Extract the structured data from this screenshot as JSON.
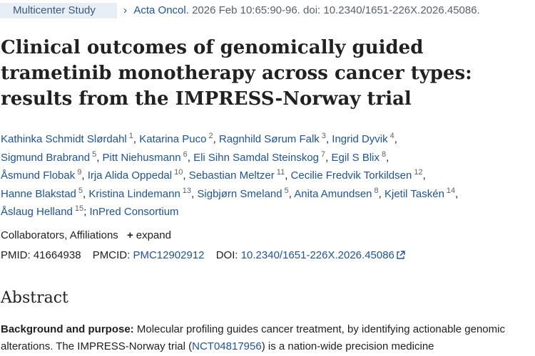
{
  "header": {
    "badge": "Multicenter Study",
    "journal": "Acta Oncol.",
    "citation": "2026 Feb 10:65:90-96. doi: 10.2340/1651-226X.2026.45086."
  },
  "title": "Clinical outcomes of genomically guided trametinib monotherapy across cancer types: results from the IMPRESS-Norway trial",
  "author_rows": [
    [
      {
        "name": "Kathinka Schmidt Slørdahl",
        "aff": "1"
      },
      {
        "name": "Katarina Puco",
        "aff": "2"
      },
      {
        "name": "Ragnhild Sørum Falk",
        "aff": "3"
      },
      {
        "name": "Ingrid Dyvik",
        "aff": "4"
      }
    ],
    [
      {
        "name": "Sigmund Brabrand",
        "aff": "5"
      },
      {
        "name": "Pitt Niehusmann",
        "aff": "6"
      },
      {
        "name": "Eli Sihn Samdal Steinskog",
        "aff": "7"
      },
      {
        "name": "Egil S Blix",
        "aff": "8"
      }
    ],
    [
      {
        "name": "Åsmund Flobak",
        "aff": "9"
      },
      {
        "name": "Irja Alida Oppedal",
        "aff": "10"
      },
      {
        "name": "Sebastian Meltzer",
        "aff": "11"
      },
      {
        "name": "Cecilie Fredvik Torkildsen",
        "aff": "12"
      }
    ],
    [
      {
        "name": "Hanne Blakstad",
        "aff": "5"
      },
      {
        "name": "Kristina Lindemann",
        "aff": "13"
      },
      {
        "name": "Sigbjørn Smeland",
        "aff": "5"
      },
      {
        "name": "Anita Amundsen",
        "aff": "8"
      },
      {
        "name": "Kjetil Taskén",
        "aff": "14"
      }
    ],
    [
      {
        "name": "Åslaug Helland",
        "aff": "15"
      },
      {
        "name": "InPred Consortium",
        "aff": ""
      }
    ]
  ],
  "collaborators": {
    "label": "Collaborators, Affiliations",
    "expand_label": "expand"
  },
  "ids": {
    "pmid_label": "PMID:",
    "pmid": "41664938",
    "pmcid_label": "PMCID:",
    "pmcid": "PMC12902912",
    "doi_label": "DOI:",
    "doi": "10.2340/1651-226X.2026.45086"
  },
  "abstract": {
    "heading": "Abstract",
    "bg_label": "Background and purpose:",
    "text_1": "Molecular profiling guides cancer treatment, by identifying actionable genomic alterations. The IMPRESS-Norway trial (",
    "trial_id": "NCT04817956",
    "text_2": ") is a nation-wide precision medicine"
  },
  "colors": {
    "link": "#205493",
    "badge_bg": "#e8eef5",
    "text": "#212121"
  }
}
